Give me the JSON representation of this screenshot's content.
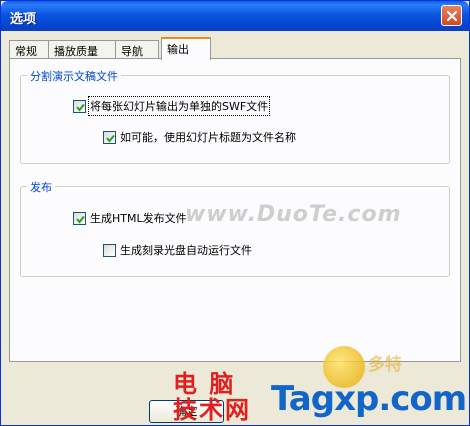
{
  "window": {
    "title": "选项"
  },
  "tabs": [
    {
      "label": "常规"
    },
    {
      "label": "播放质量"
    },
    {
      "label": "导航"
    },
    {
      "label": "输出"
    }
  ],
  "group_split": {
    "legend": "分割演示文稿文件",
    "check1": {
      "label": "将每张幻灯片输出为单独的SWF文件",
      "checked": true
    },
    "check2": {
      "label": "如可能，使用幻灯片标题为文件名称",
      "checked": true
    }
  },
  "group_publish": {
    "legend": "发布",
    "check1": {
      "label": "生成HTML发布文件",
      "checked": true
    },
    "check2": {
      "label": "生成刻录光盘自动运行文件",
      "checked": false
    }
  },
  "buttons": {
    "ok_label": "确定"
  },
  "watermarks": {
    "duote": "www.DuoTe.com",
    "logo_faint": "多特",
    "red_line1": "电 脑",
    "red_line2": "技术网",
    "blue": "Tagxp.com"
  },
  "colors": {
    "accent_blue": "#0046d5",
    "title_bar": "#0a56e0",
    "tab_highlight": "#e68b2c"
  }
}
